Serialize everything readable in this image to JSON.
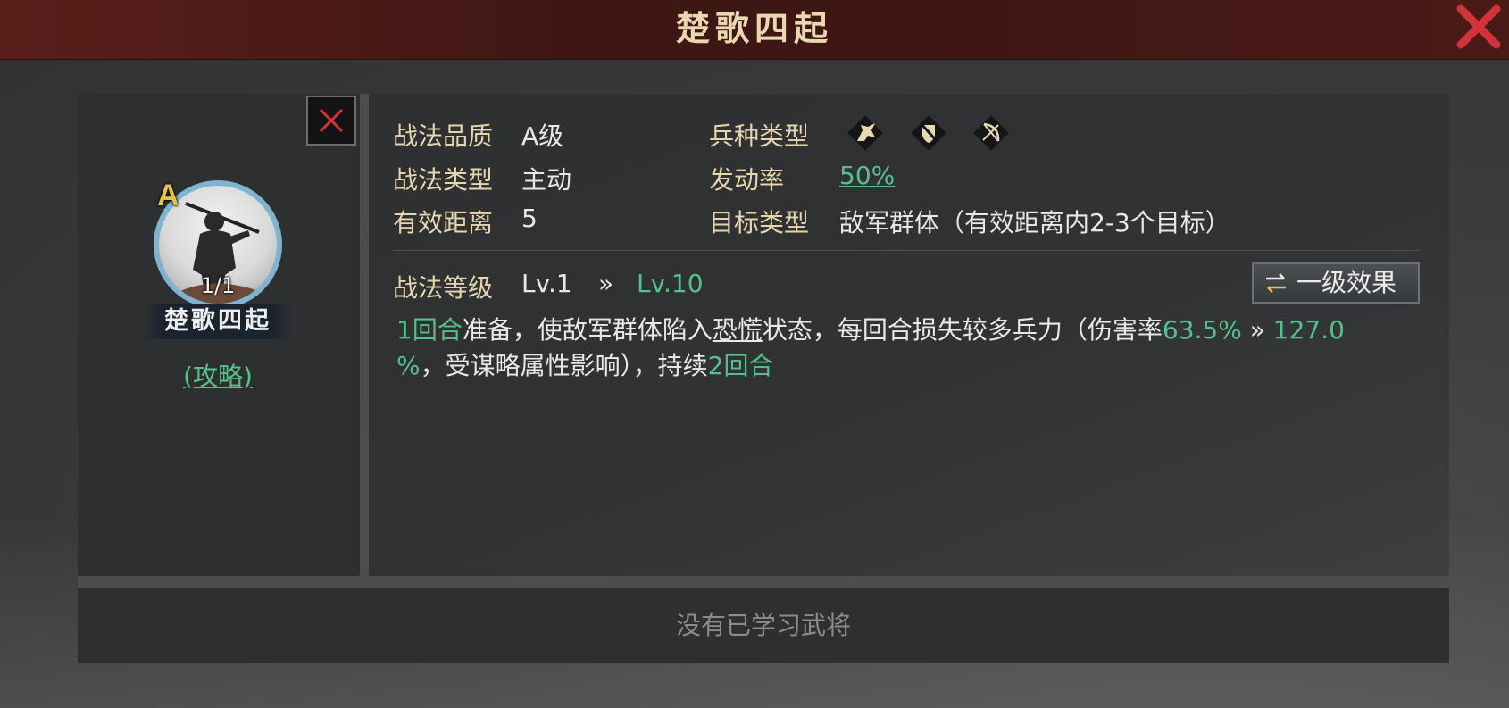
{
  "title": "楚歌四起",
  "left": {
    "grade": "A",
    "count": "1/1",
    "name": "楚歌四起",
    "guide": "(攻略)"
  },
  "info": {
    "quality_label": "战法品质",
    "quality_value": "A级",
    "troop_label": "兵种类型",
    "troop_icons": [
      "cavalry-icon",
      "shield-icon",
      "archer-icon"
    ],
    "type_label": "战法类型",
    "type_value": "主动",
    "rate_label": "发动率",
    "rate_value": "50%",
    "range_label": "有效距离",
    "range_value": "5",
    "target_label": "目标类型",
    "target_value": "敌军群体（有效距离内2-3个目标）"
  },
  "level": {
    "label": "战法等级",
    "current": "Lv.1",
    "arrow": "»",
    "max": "Lv.10",
    "effect_button": "一级效果"
  },
  "description": {
    "p1": "1回合",
    "p2": "准备，使敌军群体陷入",
    "p3": "恐慌",
    "p4": "状态，每回合损失较多兵力（伤害率",
    "p5": "63.5%",
    "p6": " » ",
    "p7": "127.0",
    "p8": "%",
    "p9": "，受谋略属性影响），持续",
    "p10": "2回合"
  },
  "footer": {
    "message": "没有已学习武将"
  },
  "colors": {
    "accent_green": "#55c08b",
    "label_gold": "#e6d6ae",
    "grade_gold": "#e8c341",
    "close_red": "#d2333a"
  }
}
